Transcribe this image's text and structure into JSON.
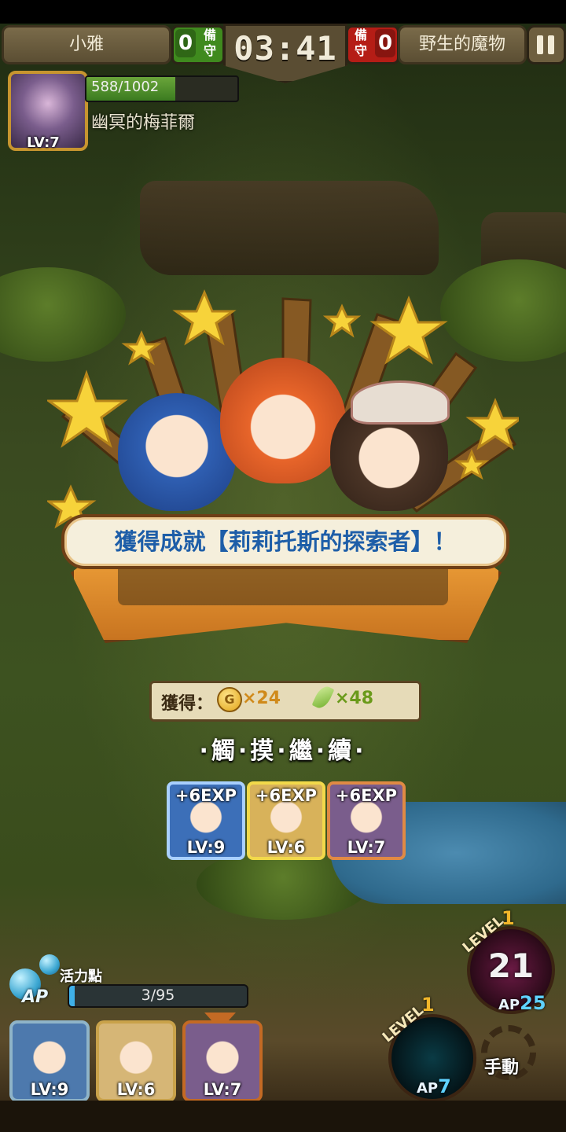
{
  "top_bar": {
    "left_team": "小雅",
    "left_guard_count": "0",
    "guard_label": "備守",
    "timer": "03:41",
    "right_guard_count": "0",
    "right_team": "野生的魔物"
  },
  "boss": {
    "level": "LV:7",
    "hp_text": "588/1002",
    "hp_fraction": 0.586,
    "name": "幽冥的梅菲爾"
  },
  "victory": {
    "achievement": "獲得成就【莉莉托斯的探索者】！",
    "rewards_label": "獲得：",
    "coin_icon_text": "G",
    "gold": "×24",
    "feather": "×48",
    "tap_continue": "·觸·摸·繼·續·"
  },
  "exp_cards": [
    {
      "exp": "+6EXP",
      "level": "LV:9",
      "border": "#a9d0ff",
      "bg": "#3c6fb8"
    },
    {
      "exp": "+6EXP",
      "level": "LV:6",
      "border": "#f2d94a",
      "bg": "#d8b25a"
    },
    {
      "exp": "+6EXP",
      "level": "LV:7",
      "border": "#e08a44",
      "bg": "#7a5d8c"
    }
  ],
  "ap": {
    "label": "活力點",
    "tag": "AP",
    "text": "3/95",
    "fraction": 0.032
  },
  "party": [
    {
      "level": "LV:9",
      "border": "#8fb4c8",
      "bg": "#4d79ad"
    },
    {
      "level": "LV:6",
      "border": "#c9a24a",
      "bg": "#d6b676"
    },
    {
      "level": "LV:7",
      "border": "#c46a24",
      "bg": "#7a5d8c"
    }
  ],
  "skills": [
    {
      "level_label": "LEVEL",
      "level": "1",
      "value": "21",
      "ap_label": "AP",
      "ap": "25"
    },
    {
      "level_label": "LEVEL",
      "level": "1",
      "ap_label": "AP",
      "ap": "7"
    }
  ],
  "manual_label": "手動",
  "colors": {
    "achievement_text": "#1e5ea8",
    "banner": "#f0a23a",
    "star": "#f7d33a"
  }
}
